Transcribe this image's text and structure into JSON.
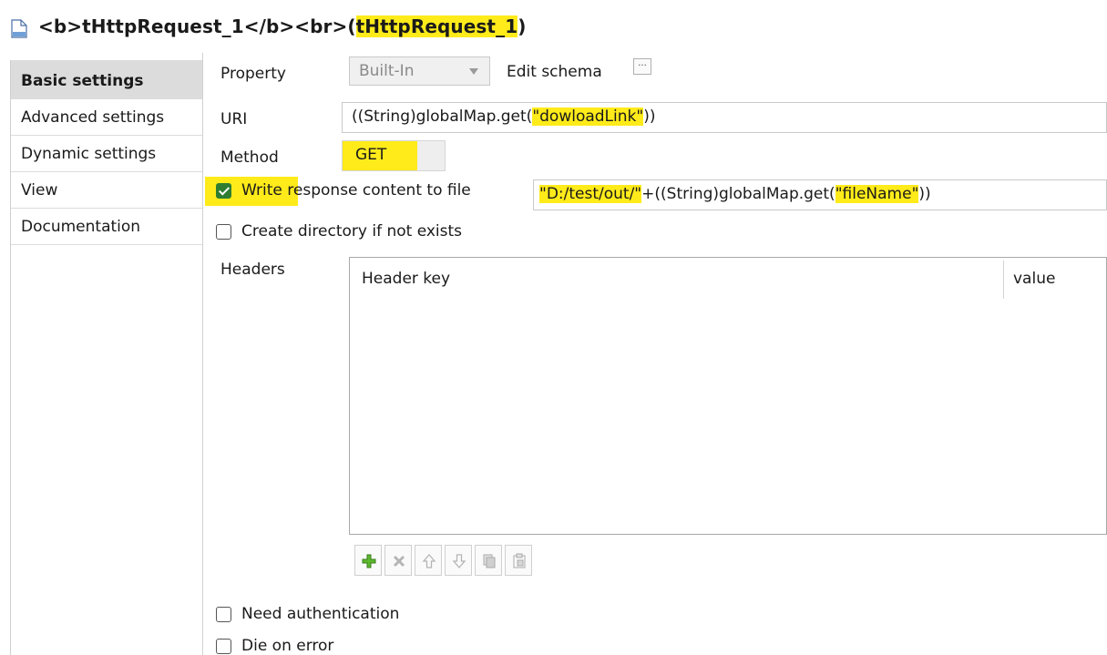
{
  "title": {
    "prefix": "<b>tHttpRequest_1</b><br>(",
    "highlight": "tHttpRequest_1",
    "suffix": ")"
  },
  "tabs": [
    {
      "label": "Basic settings",
      "active": true
    },
    {
      "label": "Advanced settings",
      "active": false
    },
    {
      "label": "Dynamic settings",
      "active": false
    },
    {
      "label": "View",
      "active": false
    },
    {
      "label": "Documentation",
      "active": false
    }
  ],
  "property": {
    "label": "Property",
    "value": "Built-In",
    "edit_schema_label": "Edit schema",
    "edit_schema_button": "..."
  },
  "uri": {
    "label": "URI",
    "value_prefix": "((String)globalMap.get(",
    "value_highlight": "\"dowloadLink\"",
    "value_suffix": "))"
  },
  "method": {
    "label": "Method",
    "value": "GET"
  },
  "write_response": {
    "label_highlight": "Write ",
    "label_rest": "response content to file",
    "checked": true,
    "value_highlight": "\"D:/test/out/\"",
    "value_middle": "+((String)globalMap.get(",
    "value_highlight2": "\"fileName\"",
    "value_suffix": "))"
  },
  "create_directory": {
    "label": "Create directory if not exists",
    "checked": false
  },
  "headers": {
    "label": "Headers",
    "columns": [
      "Header key",
      "value"
    ],
    "rows": []
  },
  "toolbar": {
    "icons": [
      "add-icon",
      "delete-icon",
      "move-up-icon",
      "move-down-icon",
      "copy-icon",
      "paste-icon"
    ]
  },
  "need_auth": {
    "label": "Need authentication",
    "checked": false
  },
  "die_on_error": {
    "label": "Die on error",
    "checked": false
  },
  "colors": {
    "highlight": "#ffeb1a",
    "check_green": "#2e7d32",
    "active_tab_bg": "#dcdcdc"
  }
}
